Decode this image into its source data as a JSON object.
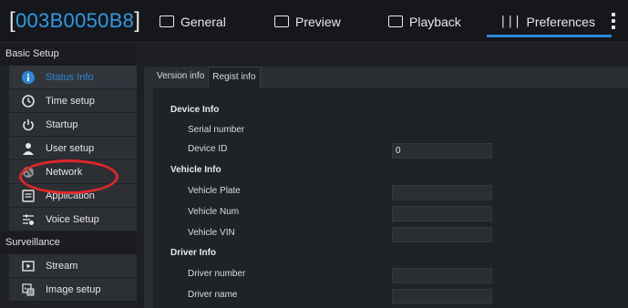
{
  "device_id": "003B0050B8",
  "tabs": [
    {
      "label": "General",
      "icon": "general-icon"
    },
    {
      "label": "Preview",
      "icon": "preview-icon"
    },
    {
      "label": "Playback",
      "icon": "playback-icon"
    },
    {
      "label": "Preferences",
      "icon": "preferences-icon",
      "active": true
    }
  ],
  "sidebar": {
    "sections": [
      {
        "title": "Basic Setup",
        "items": [
          {
            "label": "Status Info",
            "icon": "info-icon",
            "active": true
          },
          {
            "label": "Time setup",
            "icon": "clock-icon"
          },
          {
            "label": "Startup",
            "icon": "power-icon"
          },
          {
            "label": "User setup",
            "icon": "user-icon"
          },
          {
            "label": "Network",
            "icon": "network-globe-icon"
          },
          {
            "label": "Application",
            "icon": "application-icon"
          },
          {
            "label": "Voice Setup",
            "icon": "voice-settings-icon"
          }
        ]
      },
      {
        "title": "Surveillance",
        "items": [
          {
            "label": "Stream",
            "icon": "stream-icon"
          },
          {
            "label": "Image setup",
            "icon": "image-setup-icon"
          }
        ]
      }
    ]
  },
  "main": {
    "subtabs": [
      {
        "label": "Version info"
      },
      {
        "label": "Regist info",
        "active": true
      }
    ],
    "groups": {
      "device": "Device Info",
      "vehicle": "Vehicle Info",
      "driver": "Driver Info"
    },
    "fields": {
      "serial_number": {
        "label": "Serial number"
      },
      "device_id": {
        "label": "Device ID",
        "value": "0"
      },
      "vehicle_plate": {
        "label": "Vehicle Plate",
        "value": ""
      },
      "vehicle_num": {
        "label": "Vehicle Num",
        "value": ""
      },
      "vehicle_vin": {
        "label": "Vehicle VIN",
        "value": ""
      },
      "driver_number": {
        "label": "Driver number",
        "value": ""
      },
      "driver_name": {
        "label": "Driver name",
        "value": ""
      }
    }
  },
  "colors": {
    "accent": "#2f86d6",
    "device_id": "#2f9ae8",
    "highlight": "#e0262a"
  }
}
